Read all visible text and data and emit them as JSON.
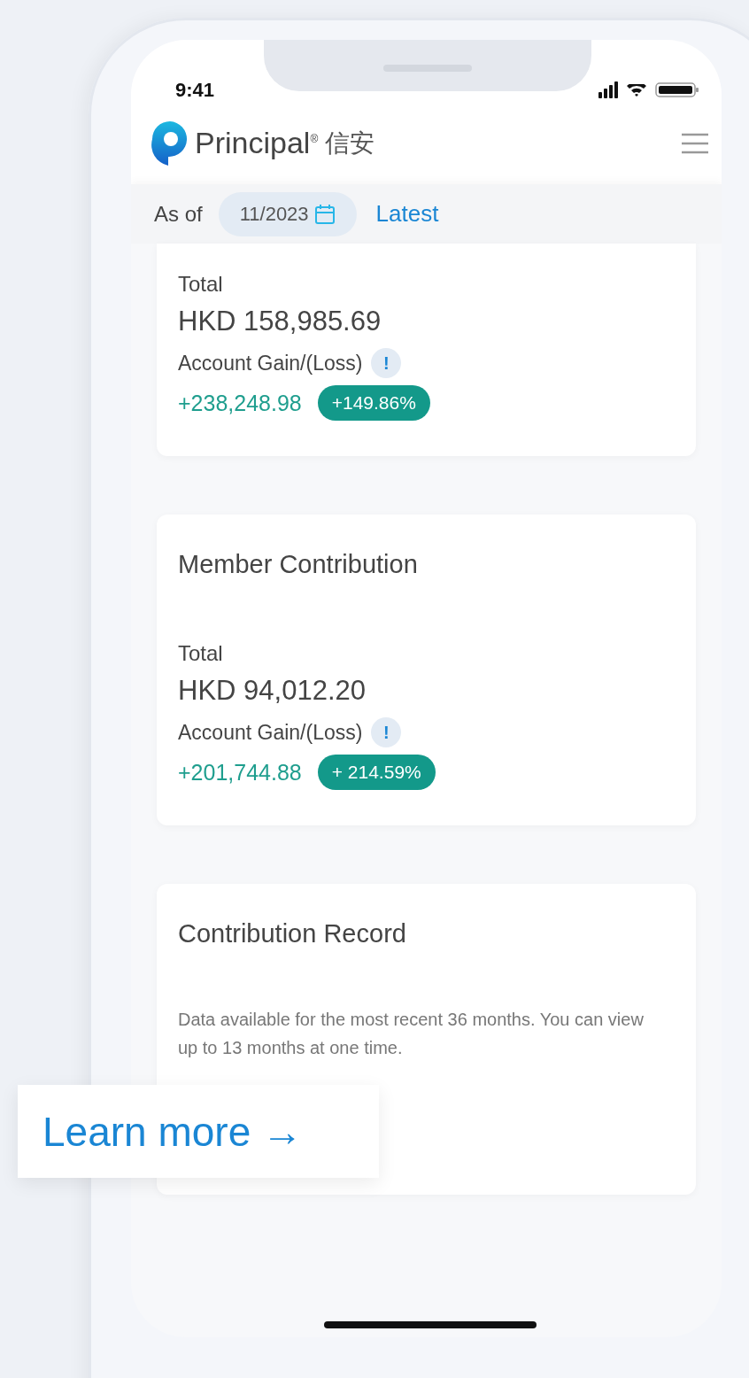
{
  "status_bar": {
    "time": "9:41"
  },
  "header": {
    "brand": "Principal$^{®}$",
    "brand_chinese": "信安"
  },
  "date_bar": {
    "label": "As of",
    "date": "11/2023",
    "latest_link": "Latest"
  },
  "cards": [
    {
      "kind": "summary",
      "total_label": "Total",
      "total": "HKD 158,985.69",
      "gain_label": "Account Gain/(Loss)",
      "info": "!",
      "gain": "+238,248.98",
      "gain_percent": "+149.86%"
    },
    {
      "kind": "summary",
      "title": "Member Contribution",
      "total_label": "Total",
      "total": "HKD 94,012.20",
      "gain_label": "Account Gain/(Loss)",
      "info": "!",
      "gain": "+201,744.88",
      "gain_percent": "+ 214.59%"
    },
    {
      "kind": "record",
      "title": "Contribution Record",
      "note": "Data available for the most recent 36 months. You can view up to 13 months at one time."
    }
  ],
  "learn_more": {
    "label": "Learn more",
    "arrow": "→"
  }
}
